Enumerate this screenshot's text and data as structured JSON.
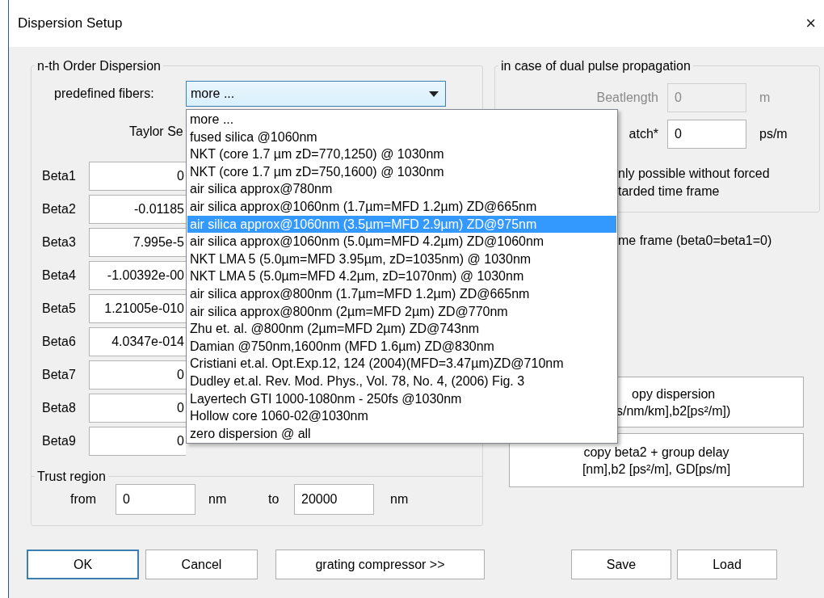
{
  "window": {
    "title": "Dispersion Setup",
    "close": "×"
  },
  "dispersion": {
    "title": "n-th Order Dispersion",
    "fibers_label": "predefined fibers:",
    "fibers_value": "more ...",
    "taylor_label": "Taylor Se",
    "betas": [
      {
        "label": "Beta1",
        "value": "0"
      },
      {
        "label": "Beta2",
        "value": "-0.01185"
      },
      {
        "label": "Beta3",
        "value": "7.995e-5"
      },
      {
        "label": "Beta4",
        "value": "-1.00392e-00"
      },
      {
        "label": "Beta5",
        "value": "1.21005e-010"
      },
      {
        "label": "Beta6",
        "value": "4.0347e-014"
      },
      {
        "label": "Beta7",
        "value": "0"
      },
      {
        "label": "Beta8",
        "value": "0"
      },
      {
        "label": "Beta9",
        "value": "0"
      }
    ]
  },
  "trust_region": {
    "title": "Trust region",
    "from_label": "from",
    "from_value": "0",
    "from_unit": "nm",
    "to_label": "to",
    "to_value": "20000",
    "to_unit": "nm"
  },
  "dual_pulse": {
    "title": "in case of dual pulse propagation",
    "rows": [
      {
        "label": "Beatlength",
        "value": "0",
        "unit": "m",
        "disabled": true
      },
      {
        "label": "atch*",
        "value": "0",
        "unit": "ps/m",
        "disabled": false
      }
    ],
    "note": "nly possible without forced\ntarded time frame"
  },
  "frame_text": "me frame (beta0=beta1=0)",
  "copy_buttons": [
    {
      "label": "opy dispersion\ns/nm/km],b2[ps²/m])"
    },
    {
      "label": "copy beta2 + group delay\n[nm],b2 [ps²/m], GD[ps/m]"
    }
  ],
  "buttons": [
    {
      "label": "OK",
      "default": true
    },
    {
      "label": "Cancel",
      "default": false
    },
    {
      "label": "grating compressor >>",
      "default": false
    },
    {
      "label": "Save",
      "default": false
    },
    {
      "label": "Load",
      "default": false
    }
  ],
  "fiber_list": [
    {
      "label": "more ...",
      "selected": false
    },
    {
      "label": "fused silica @1060nm",
      "selected": false
    },
    {
      "label": "NKT (core 1.7 µm zD=770,1250) @ 1030nm",
      "selected": false
    },
    {
      "label": "NKT (core 1.7 µm zD=750,1600) @ 1030nm",
      "selected": false
    },
    {
      "label": "air silica approx@780nm",
      "selected": false
    },
    {
      "label": "air silica approx@1060nm (1.7µm=MFD 1.2µm) ZD@665nm",
      "selected": false
    },
    {
      "label": "air silica approx@1060nm (3.5µm=MFD 2.9µm) ZD@975nm",
      "selected": true
    },
    {
      "label": "air silica approx@1060nm (5.0µm=MFD 4.2µm) ZD@1060nm",
      "selected": false
    },
    {
      "label": "NKT LMA 5 (5.0µm=MFD 3.95µm, zD=1035nm) @ 1030nm",
      "selected": false
    },
    {
      "label": "NKT LMA 5 (5.0µm=MFD 4.2µm, zD=1070nm) @ 1030nm",
      "selected": false
    },
    {
      "label": "air silica approx@800nm (1.7µm=MFD 1.2µm) ZD@665nm",
      "selected": false
    },
    {
      "label": "air silica approx@800nm (2µm=MFD 2µm) ZD@770nm",
      "selected": false
    },
    {
      "label": "Zhu et. al. @800nm (2µm=MFD 2µm) ZD@743nm",
      "selected": false
    },
    {
      "label": "Damian @750nm,1600nm (MFD 1.6µm) ZD@830nm",
      "selected": false
    },
    {
      "label": "Cristiani et.al. Opt.Exp.12, 124 (2004)(MFD=3.47µm)ZD@710nm",
      "selected": false
    },
    {
      "label": "Dudley et.al. Rev. Mod. Phys., Vol. 78, No. 4, (2006) Fig. 3",
      "selected": false
    },
    {
      "label": "Layertech GTI 1000-1080nm - 250fs @1030nm",
      "selected": false
    },
    {
      "label": "Hollow core 1060-02@1030nm",
      "selected": false
    },
    {
      "label": "zero dispersion @ all",
      "selected": false
    }
  ]
}
